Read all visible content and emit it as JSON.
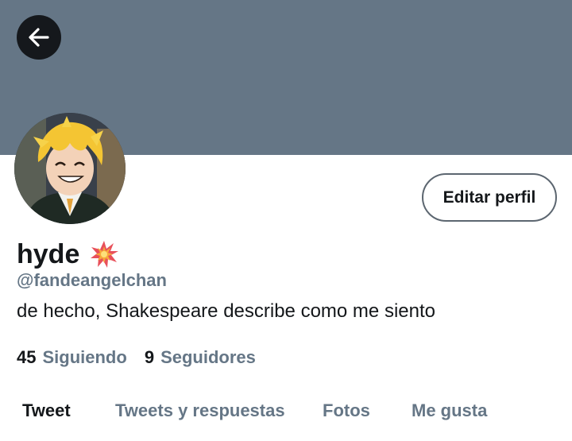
{
  "header": {
    "back_icon": "arrow-left-icon",
    "banner_color": "#657686"
  },
  "profile": {
    "avatar_icon": "avatar-image",
    "edit_button_label": "Editar perfil",
    "display_name": "hyde",
    "name_emoji": "collision-emoji",
    "handle": "@fandeangelchan",
    "bio": "de hecho, Shakespeare describe como me siento"
  },
  "stats": {
    "following": {
      "count": "45",
      "label": "Siguiendo"
    },
    "followers": {
      "count": "9",
      "label": "Seguidores"
    }
  },
  "tabs": [
    {
      "label": "Tweet",
      "active": true
    },
    {
      "label": "Tweets y respuestas",
      "active": false
    },
    {
      "label": "Fotos",
      "active": false
    },
    {
      "label": "Me gusta",
      "active": false
    }
  ],
  "colors": {
    "text_primary": "#14171a",
    "text_secondary": "#657686",
    "button_border": "#5c6670"
  }
}
